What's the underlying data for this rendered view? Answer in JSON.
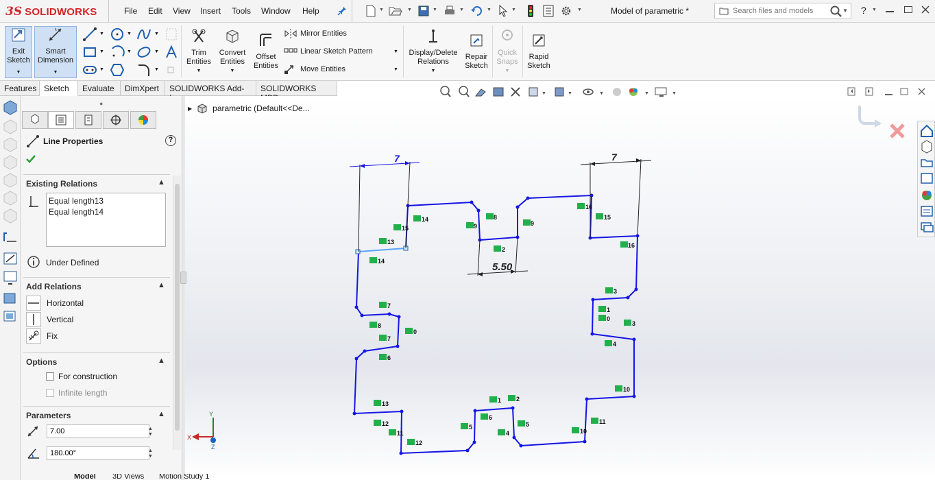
{
  "app": {
    "logo_ds": "3S",
    "logo_name": "SOLIDWORKS",
    "document_title": "Model of parametric *"
  },
  "menu": [
    "File",
    "Edit",
    "View",
    "Insert",
    "Tools",
    "Window",
    "Help"
  ],
  "search": {
    "placeholder": "Search files and models"
  },
  "help_glyph": "?",
  "ribbon": {
    "exit_sketch": "Exit\nSketch",
    "smart_dimension": "Smart\nDimension",
    "trim": "Trim\nEntities",
    "convert": "Convert\nEntities",
    "offset": "Offset\nEntities",
    "mirror": "Mirror Entities",
    "linear_pattern": "Linear Sketch Pattern",
    "move": "Move Entities",
    "display_delete": "Display/Delete\nRelations",
    "repair": "Repair\nSketch",
    "quick_snaps": "Quick\nSnaps",
    "rapid_sketch": "Rapid\nSketch"
  },
  "tabs": [
    "Features",
    "Sketch",
    "Evaluate",
    "DimXpert",
    "SOLIDWORKS Add-Ins",
    "SOLIDWORKS MBD"
  ],
  "active_tab": "Sketch",
  "tree": {
    "item": "parametric  (Default<<De..."
  },
  "property_manager": {
    "title": "Line Properties",
    "help": "?",
    "existing_relations": {
      "title": "Existing Relations",
      "items": [
        "Equal length13",
        "Equal length14"
      ],
      "status": "Under Defined"
    },
    "add_relations": {
      "title": "Add Relations",
      "items": [
        "Horizontal",
        "Vertical",
        "Fix"
      ]
    },
    "options": {
      "title": "Options",
      "for_construction": "For construction",
      "infinite_length": "Infinite length"
    },
    "parameters": {
      "title": "Parameters",
      "length": "7.00",
      "angle": "180.00°"
    }
  },
  "bottom_tabs": [
    "Model",
    "3D Views",
    "Motion Study 1"
  ],
  "sketch": {
    "dimensions": [
      "7",
      "7",
      "5.50"
    ],
    "relations": [
      "15",
      "14",
      "13",
      "14",
      "8",
      "9",
      "9",
      "2",
      "16",
      "15",
      "16",
      "7",
      "8",
      "0",
      "7",
      "6",
      "3",
      "1",
      "0",
      "3",
      "4",
      "10",
      "13",
      "12",
      "11",
      "12",
      "1",
      "2",
      "6",
      "5",
      "4",
      "5",
      "11",
      "10"
    ]
  },
  "triad": {
    "x": "X",
    "y": "Y",
    "z": "Z"
  },
  "colors": {
    "sketch_line": "#1515e6",
    "selected_line": "#59a5ff",
    "relation_icon": "#22b04b",
    "accent_red": "#d2232a"
  }
}
